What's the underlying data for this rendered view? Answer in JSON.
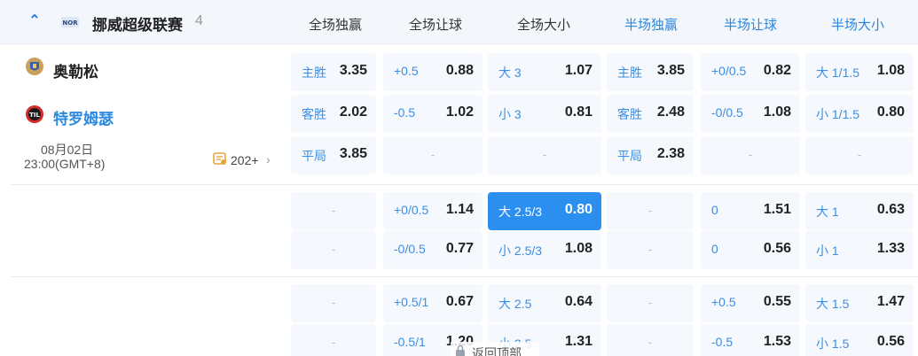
{
  "league": {
    "name": "挪威超级联赛",
    "count": "4"
  },
  "columns": [
    "全场独赢",
    "全场让球",
    "全场大小",
    "半场独赢",
    "半场让球",
    "半场大小"
  ],
  "match": {
    "home": "奥勒松",
    "away": "特罗姆瑟",
    "date": "08月02日",
    "time": "23:00(GMT+8)",
    "more": "202+"
  },
  "dash": "-",
  "back_to_top": "返回顶部",
  "colors": {
    "accent": "#2b8ff0",
    "label": "#3a8ee6",
    "cell_bg": "#f5f8fc"
  },
  "rows": [
    [
      {
        "l": "主胜",
        "v": "3.35"
      },
      {
        "l": "+0.5",
        "v": "0.88"
      },
      {
        "l": "大 3",
        "v": "1.07"
      },
      {
        "l": "主胜",
        "v": "3.85"
      },
      {
        "l": "+0/0.5",
        "v": "0.82"
      },
      {
        "l": "大 1/1.5",
        "v": "1.08"
      }
    ],
    [
      {
        "l": "客胜",
        "v": "2.02"
      },
      {
        "l": "-0.5",
        "v": "1.02"
      },
      {
        "l": "小 3",
        "v": "0.81"
      },
      {
        "l": "客胜",
        "v": "2.48"
      },
      {
        "l": "-0/0.5",
        "v": "1.08"
      },
      {
        "l": "小 1/1.5",
        "v": "0.80"
      }
    ],
    [
      {
        "l": "平局",
        "v": "3.85"
      },
      null,
      null,
      {
        "l": "平局",
        "v": "2.38"
      },
      null,
      null
    ],
    [
      null,
      {
        "l": "+0/0.5",
        "v": "1.14"
      },
      {
        "l": "大 2.5/3",
        "v": "0.80",
        "active": true
      },
      null,
      {
        "l": "0",
        "v": "1.51"
      },
      {
        "l": "大 1",
        "v": "0.63"
      }
    ],
    [
      null,
      {
        "l": "-0/0.5",
        "v": "0.77"
      },
      {
        "l": "小 2.5/3",
        "v": "1.08"
      },
      null,
      {
        "l": "0",
        "v": "0.56"
      },
      {
        "l": "小 1",
        "v": "1.33"
      }
    ],
    [
      null,
      {
        "l": "+0.5/1",
        "v": "0.67"
      },
      {
        "l": "大 2.5",
        "v": "0.64"
      },
      null,
      {
        "l": "+0.5",
        "v": "0.55"
      },
      {
        "l": "大 1.5",
        "v": "1.47"
      }
    ],
    [
      null,
      {
        "l": "-0.5/1",
        "v": "1.20"
      },
      {
        "l": "小 2.5",
        "v": "1.31"
      },
      null,
      {
        "l": "-0.5",
        "v": "1.53"
      },
      {
        "l": "小 1.5",
        "v": "0.56"
      }
    ]
  ]
}
